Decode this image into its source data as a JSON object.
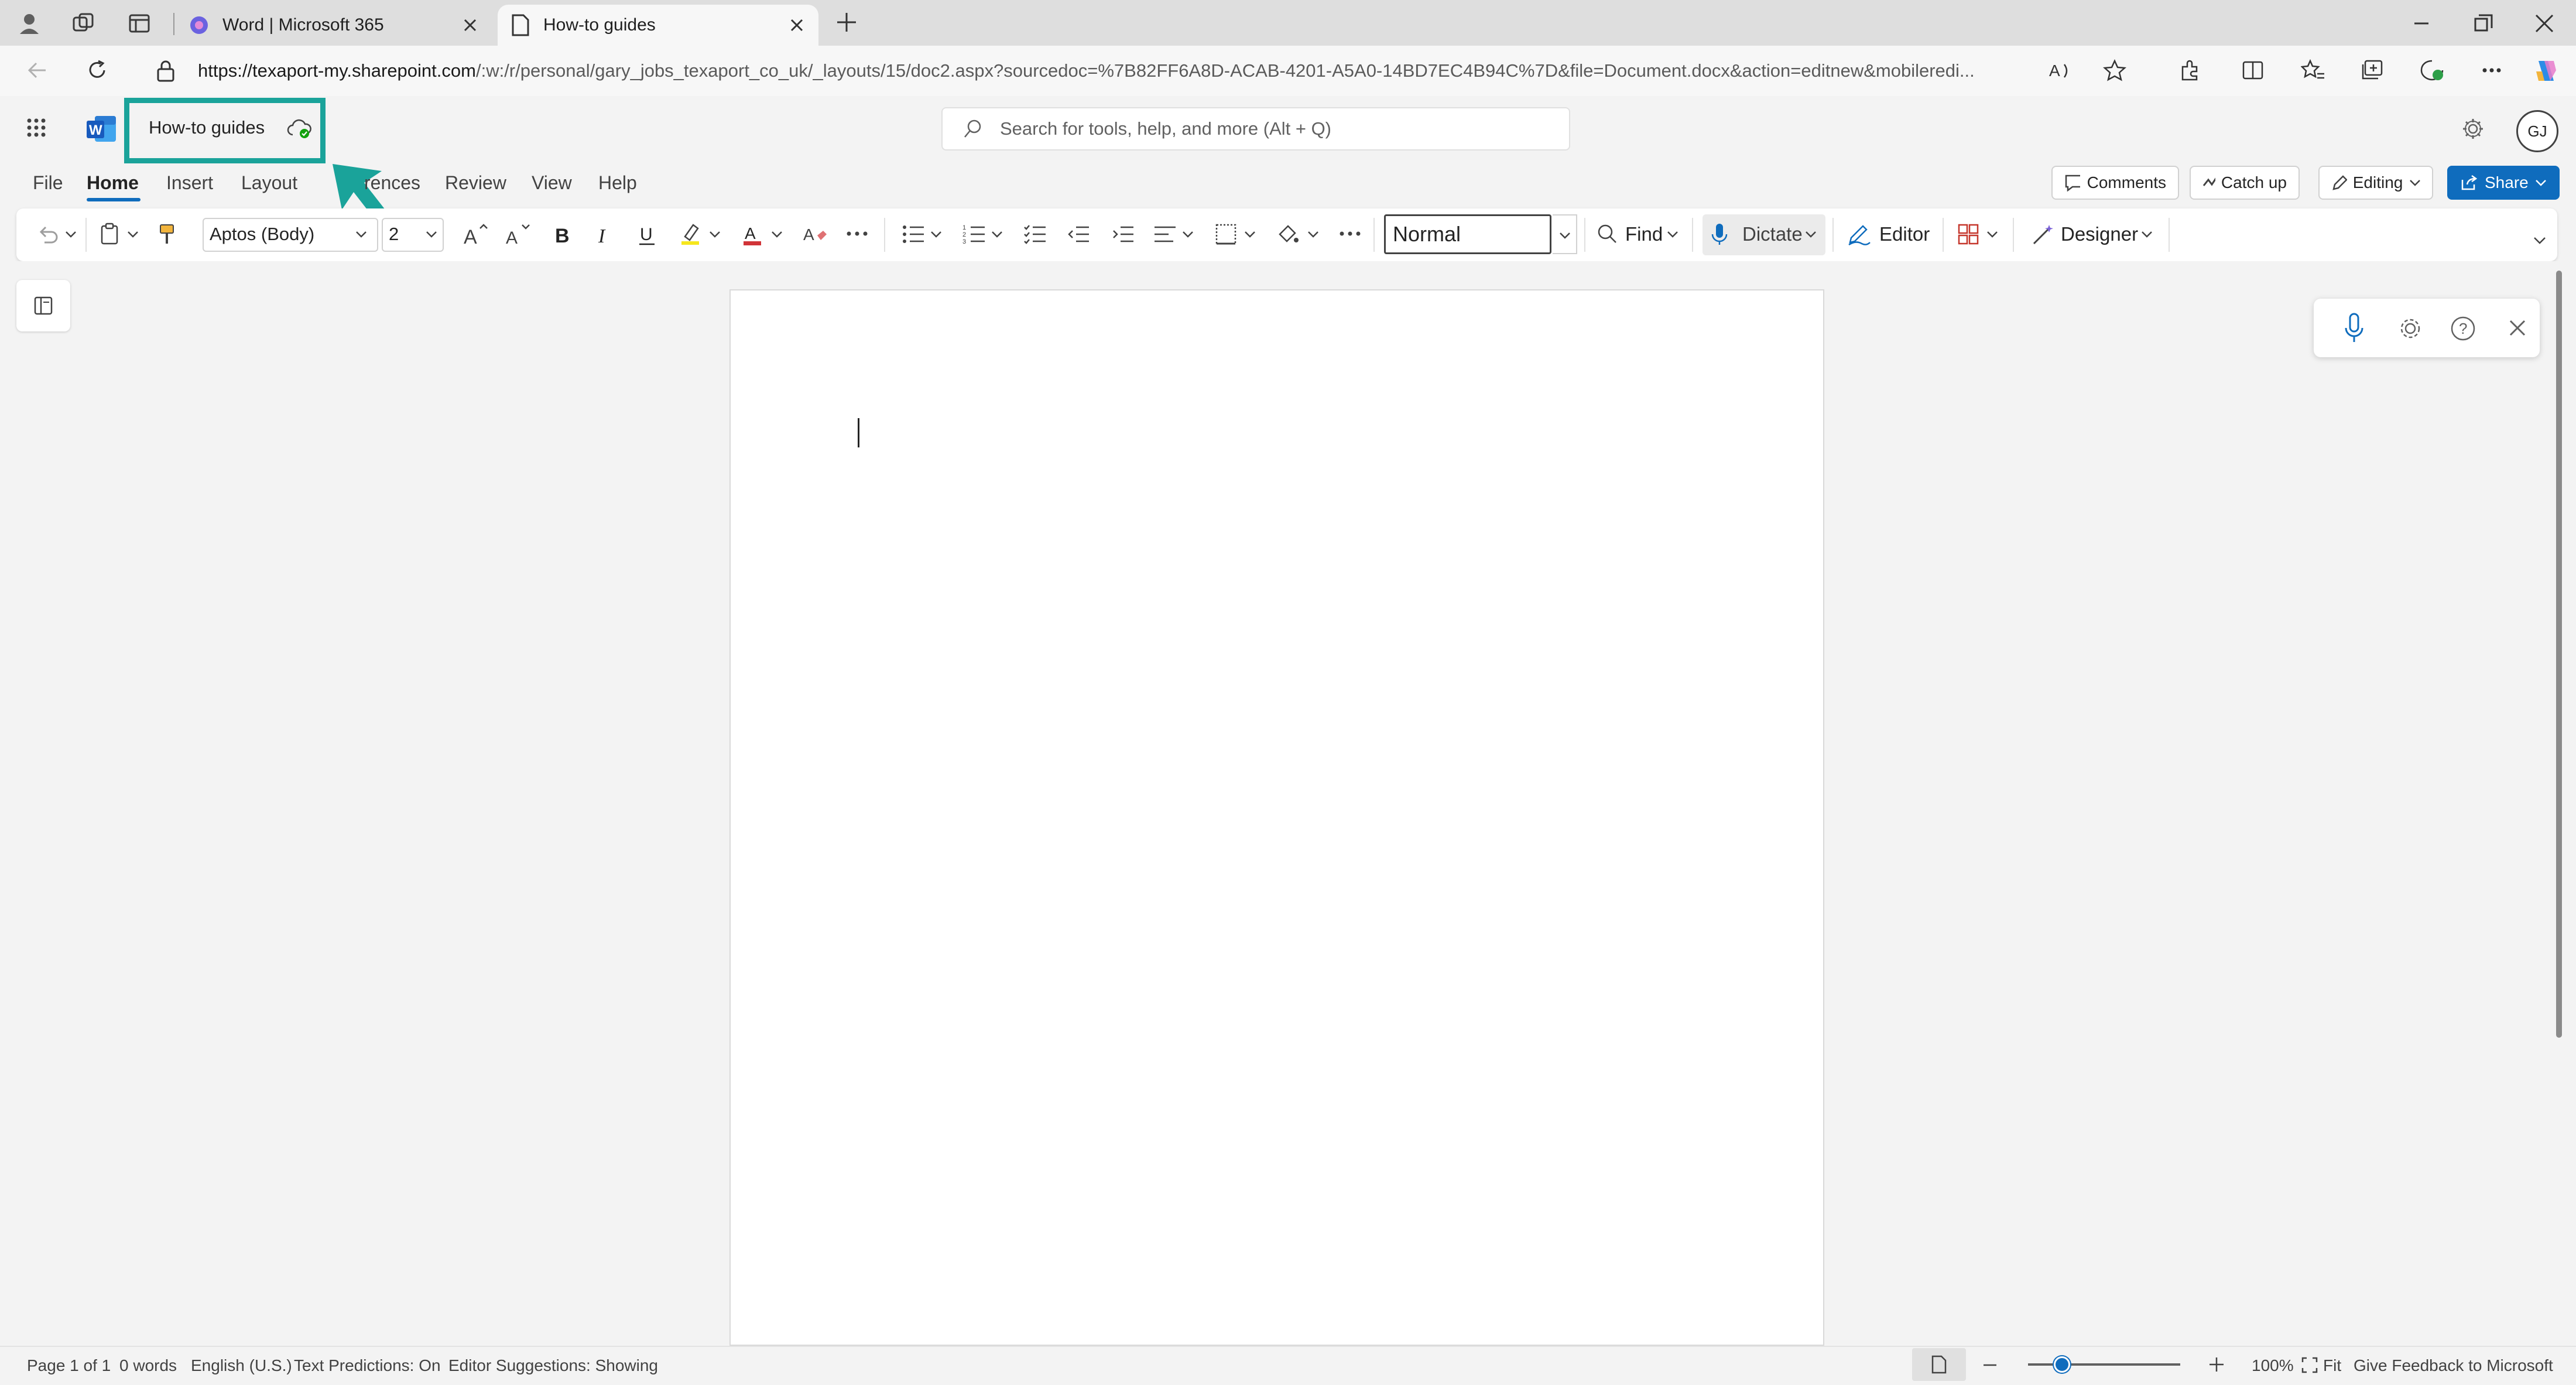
{
  "browser": {
    "tabs": [
      {
        "label": "Word | Microsoft 365",
        "icon": "copilot-icon"
      },
      {
        "label": "How-to guides",
        "icon": "page-icon"
      }
    ],
    "url_host": "https://texaport-my.sharepoint.com",
    "url_path": "/:w:/r/personal/gary_jobs_texaport_co_uk/_layouts/15/doc2.aspx?sourcedoc=%7B82FF6A8D-ACAB-4201-A5A0-14BD7EC4B94C%7D&file=Document.docx&action=editnew&mobileredi..."
  },
  "app": {
    "doc_title": "How-to guides",
    "search_placeholder": "Search for tools, help, and more (Alt + Q)",
    "avatar_initials": "GJ"
  },
  "ribbon": {
    "tabs": [
      "File",
      "Home",
      "Insert",
      "Layout",
      "rences",
      "Review",
      "View",
      "Help"
    ],
    "comments_label": "Comments",
    "catchup_label": "Catch up",
    "editing_label": "Editing",
    "share_label": "Share"
  },
  "toolbar": {
    "font_name": "Aptos (Body)",
    "font_size": "2",
    "style": "Normal",
    "find_label": "Find",
    "dictate_label": "Dictate",
    "editor_label": "Editor",
    "designer_label": "Designer"
  },
  "status": {
    "page": "Page 1 of 1",
    "words": "0 words",
    "language": "English (U.S.)",
    "predictions": "Text Predictions: On",
    "suggestions": "Editor Suggestions: Showing",
    "zoom": "100%",
    "fit": "Fit",
    "feedback": "Give Feedback to Microsoft"
  },
  "annotation": {
    "color": "#1aa39a"
  }
}
